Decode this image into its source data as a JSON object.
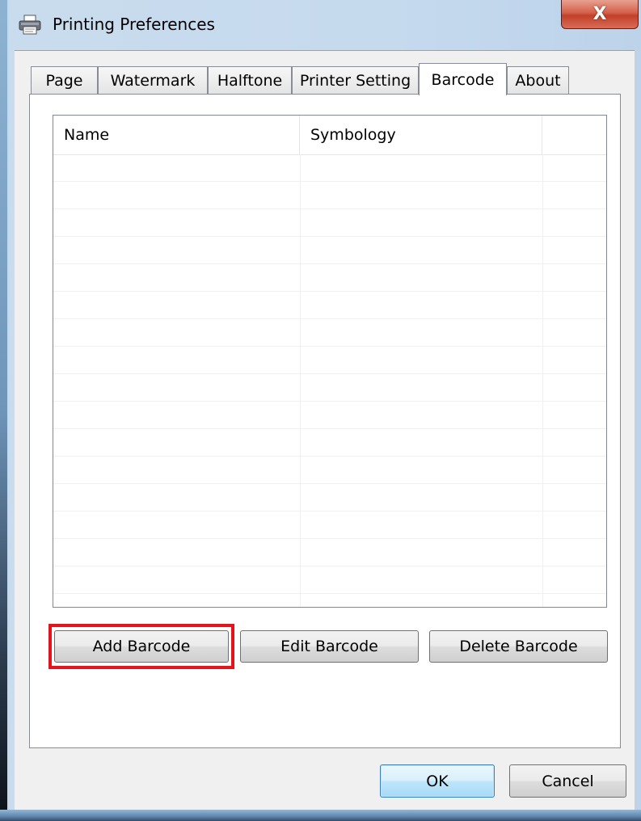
{
  "window": {
    "title": "Printing Preferences",
    "close_glyph": "X"
  },
  "tabs": [
    {
      "label": "Page",
      "active": false
    },
    {
      "label": "Watermark",
      "active": false
    },
    {
      "label": "Halftone",
      "active": false
    },
    {
      "label": "Printer Setting",
      "active": false
    },
    {
      "label": "Barcode",
      "active": true
    },
    {
      "label": "About",
      "active": false
    }
  ],
  "barcode_list": {
    "columns": [
      "Name",
      "Symbology",
      ""
    ],
    "rows": []
  },
  "actions": {
    "add": "Add Barcode",
    "edit": "Edit Barcode",
    "delete": "Delete Barcode"
  },
  "footer": {
    "ok": "OK",
    "cancel": "Cancel"
  },
  "highlight_color": "#e3141b",
  "icons": {
    "title_icon": "printer-icon",
    "close_icon": "close-icon"
  }
}
